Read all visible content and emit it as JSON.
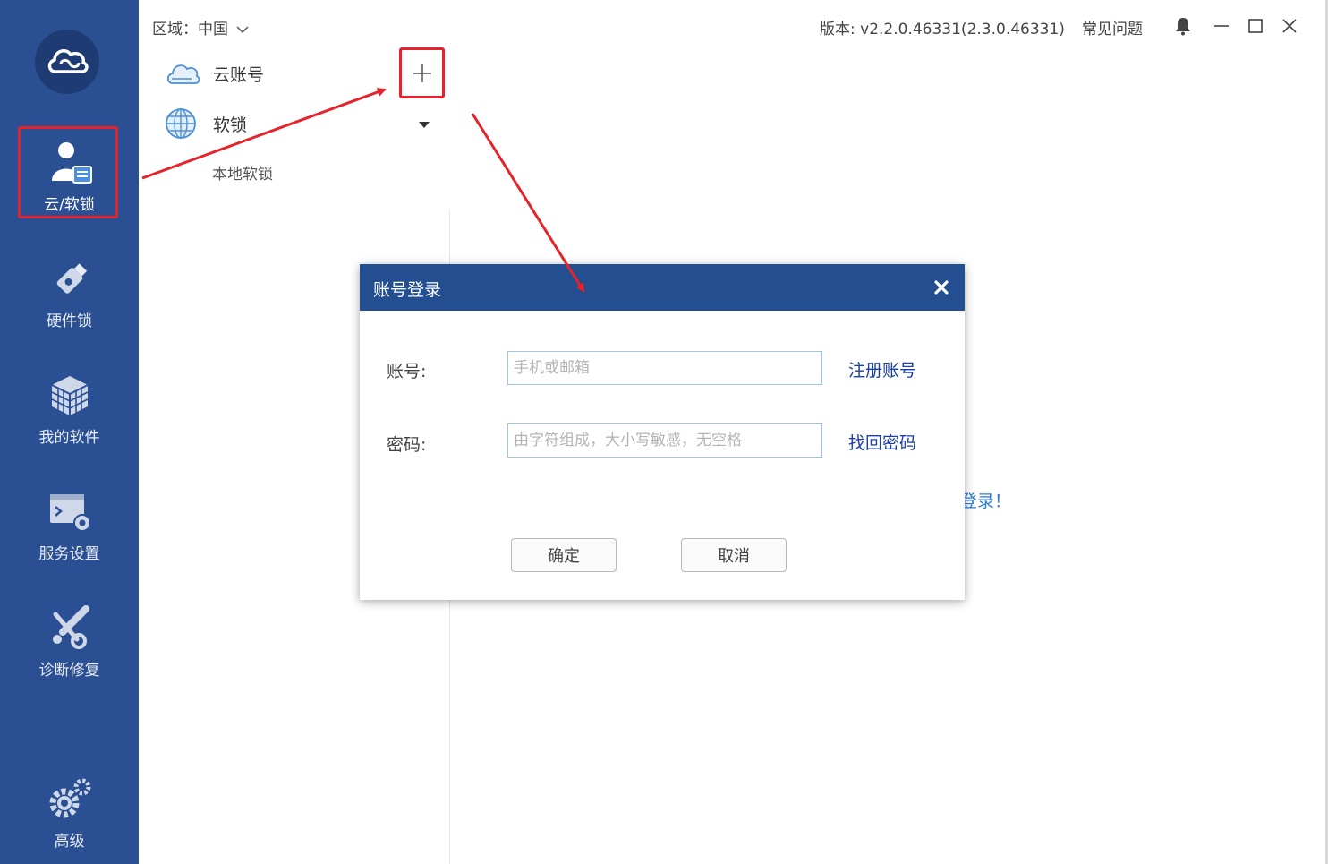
{
  "sidebar": {
    "items": [
      {
        "label": "云/软锁",
        "icon": "cloud-user-icon"
      },
      {
        "label": "硬件锁",
        "icon": "usb-dongle-icon"
      },
      {
        "label": "我的软件",
        "icon": "cube-icon"
      },
      {
        "label": "服务设置",
        "icon": "terminal-gear-icon"
      },
      {
        "label": "诊断修复",
        "icon": "wrench-icon"
      },
      {
        "label": "高级",
        "icon": "gears-icon"
      }
    ],
    "bg_color": "#2b4f93"
  },
  "topbar": {
    "region": "区域：中国",
    "version": "版本: v2.2.0.46331(2.3.0.46331)",
    "faq": "常见问题"
  },
  "tree": {
    "cloud_account": "云账号",
    "soft_lock": "软锁",
    "local_soft_lock": "本地软锁"
  },
  "background_text": "登录！",
  "dialog": {
    "title": "账号登录",
    "account_label": "账号:",
    "account_placeholder": "手机或邮箱",
    "account_value": "",
    "register_link": "注册账号",
    "password_label": "密码:",
    "password_placeholder": "由字符组成，大小写敏感，无空格",
    "password_value": "",
    "recover_link": "找回密码",
    "ok_label": "确定",
    "cancel_label": "取消",
    "header_color": "#234f91"
  },
  "annotation_color": "#e6232a"
}
